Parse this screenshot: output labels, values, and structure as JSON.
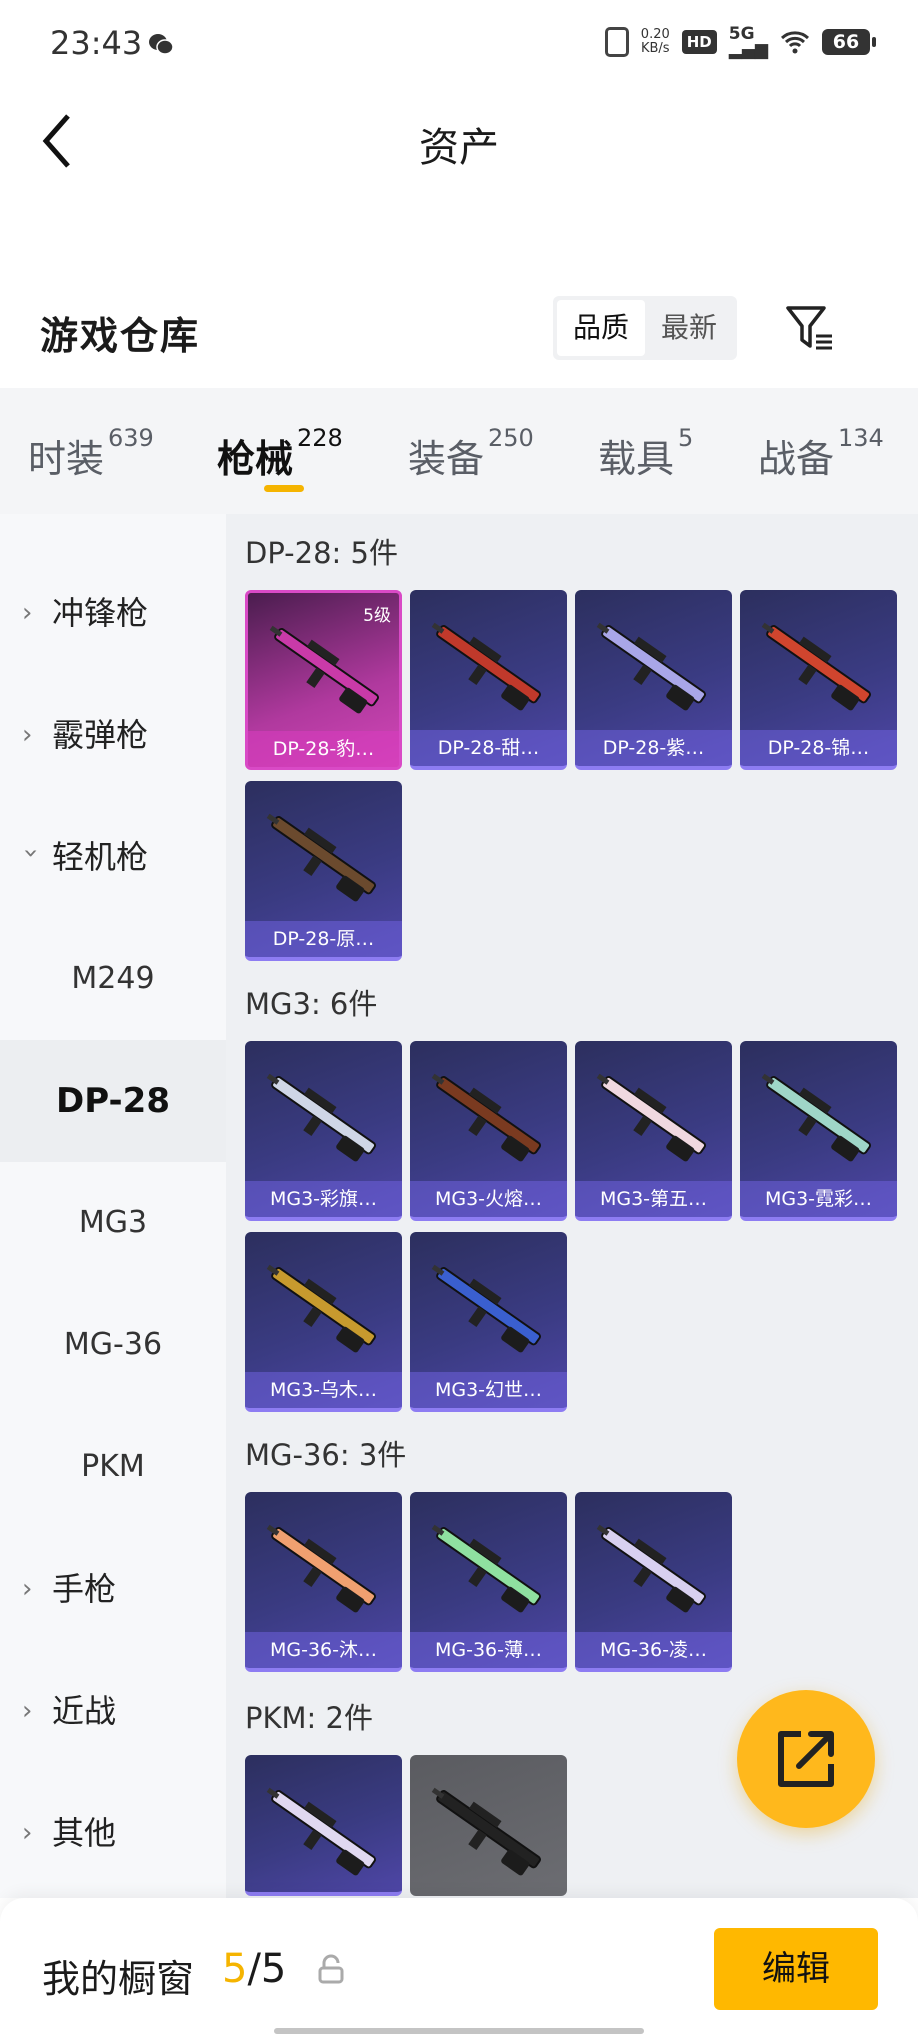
{
  "status_bar": {
    "time": "23:43",
    "net_speed_value": "0.20",
    "net_speed_unit": "KB/s",
    "hd": "HD",
    "signal": "5G",
    "battery": "66"
  },
  "header": {
    "title": "资产"
  },
  "section": {
    "title": "游戏仓库",
    "sort_options": [
      "品质",
      "最新"
    ],
    "sort_selected": "品质"
  },
  "tabs": [
    {
      "label": "时装",
      "count": "639"
    },
    {
      "label": "枪械",
      "count": "228"
    },
    {
      "label": "装备",
      "count": "250"
    },
    {
      "label": "载具",
      "count": "5"
    },
    {
      "label": "战备",
      "count": "134"
    }
  ],
  "active_tab": "枪械",
  "sidebar": {
    "categories": [
      {
        "label": "冲锋枪",
        "expanded": false
      },
      {
        "label": "霰弹枪",
        "expanded": false
      },
      {
        "label": "轻机枪",
        "expanded": true
      },
      {
        "label": "手枪",
        "expanded": false
      },
      {
        "label": "近战",
        "expanded": false
      },
      {
        "label": "其他",
        "expanded": false
      }
    ],
    "subitems": [
      "M249",
      "DP-28",
      "MG3",
      "MG-36",
      "PKM"
    ],
    "active_subitem": "DP-28"
  },
  "groups": [
    {
      "title": "DP-28: 5件",
      "items": [
        {
          "name": "DP-28-豹…",
          "level": "5级",
          "color": "#c93aa8"
        },
        {
          "name": "DP-28-甜…",
          "color": "#c0392b"
        },
        {
          "name": "DP-28-紫…",
          "color": "#a9a6e8"
        },
        {
          "name": "DP-28-锦…",
          "color": "#d0452e"
        },
        {
          "name": "DP-28-原…",
          "color": "#6b4a2e"
        }
      ]
    },
    {
      "title": "MG3: 6件",
      "items": [
        {
          "name": "MG3-彩旗…",
          "color": "#cfd6e6"
        },
        {
          "name": "MG3-火熔…",
          "color": "#7a3a20"
        },
        {
          "name": "MG3-第五…",
          "color": "#f0d8e0"
        },
        {
          "name": "MG3-霓彩…",
          "color": "#9fd6c8"
        },
        {
          "name": "MG3-乌木…",
          "color": "#c79a2e"
        },
        {
          "name": "MG3-幻世…",
          "color": "#3a5fcf"
        }
      ]
    },
    {
      "title": "MG-36: 3件",
      "items": [
        {
          "name": "MG-36-沐…",
          "color": "#f0a070"
        },
        {
          "name": "MG-36-薄…",
          "color": "#8fe0a0"
        },
        {
          "name": "MG-36-凌…",
          "color": "#d8d0f0"
        }
      ]
    },
    {
      "title": "PKM: 2件",
      "items": [
        {
          "name": "",
          "color": "#e0d8f0"
        },
        {
          "name": "",
          "color": "#222222"
        }
      ]
    }
  ],
  "bottom": {
    "label": "我的橱窗",
    "count_current": "5",
    "count_sep_total": "/5",
    "edit_label": "编辑"
  }
}
